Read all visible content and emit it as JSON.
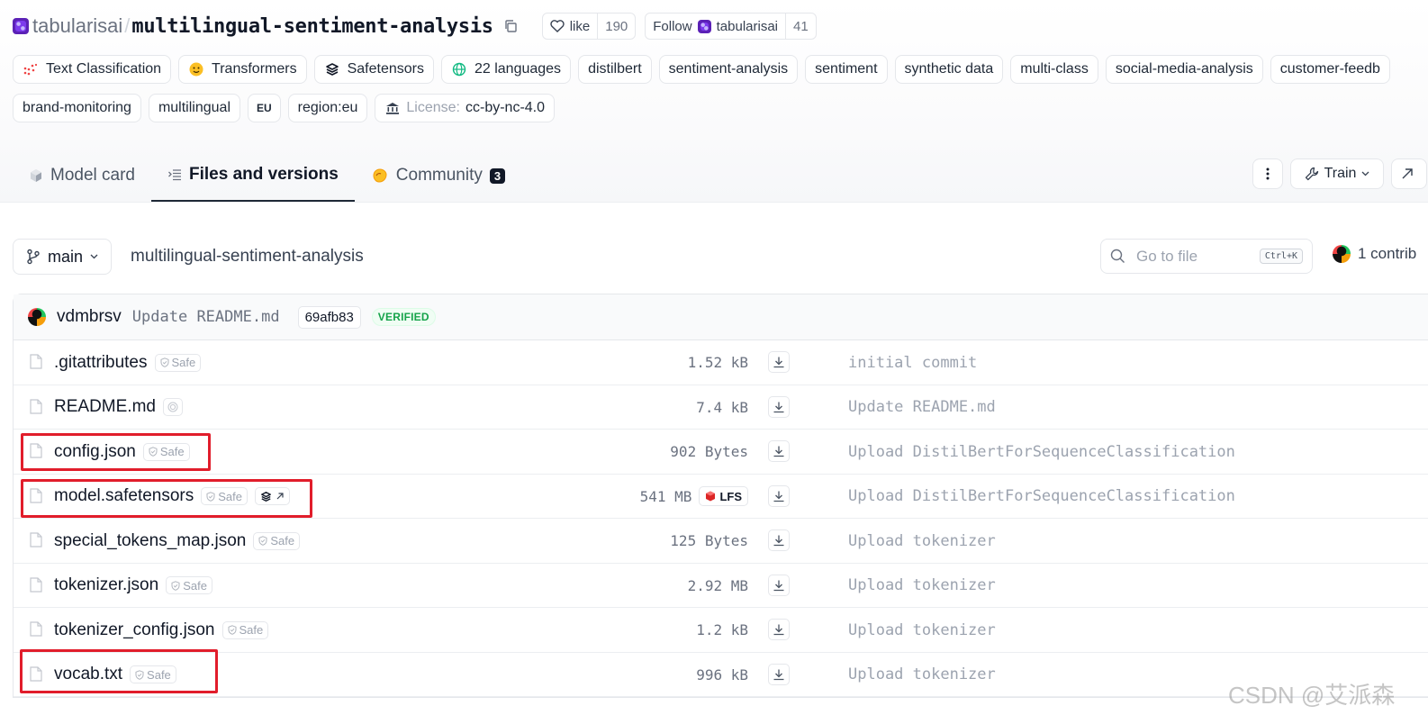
{
  "repo": {
    "org": "tabularisai",
    "separator": "/",
    "name": "multilingual-sentiment-analysis",
    "like_label": "like",
    "like_count": "190",
    "follow_label": "Follow",
    "follow_org": "tabularisai",
    "follow_count": "41"
  },
  "tags_row1": [
    {
      "label": "Text Classification",
      "icon": "text-classification-icon"
    },
    {
      "label": "Transformers",
      "icon": "hugging-face-icon"
    },
    {
      "label": "Safetensors",
      "icon": "safetensors-icon"
    },
    {
      "label": "22 languages",
      "icon": "globe-icon"
    },
    {
      "label": "distilbert"
    },
    {
      "label": "sentiment-analysis"
    },
    {
      "label": "sentiment"
    },
    {
      "label": "synthetic data"
    },
    {
      "label": "multi-class"
    },
    {
      "label": "social-media-analysis"
    },
    {
      "label": "customer-feedb"
    }
  ],
  "tags_row2": [
    {
      "label": "brand-monitoring"
    },
    {
      "label": "multilingual"
    },
    {
      "label": "EU"
    },
    {
      "label": "region:eu"
    },
    {
      "license_prefix": "License:",
      "label": "cc-by-nc-4.0",
      "icon": "bank-icon"
    }
  ],
  "tabs": {
    "model_card": "Model card",
    "files": "Files and versions",
    "community": "Community",
    "community_count": "3"
  },
  "actions": {
    "train": "Train"
  },
  "branch": {
    "name": "main",
    "path": "multilingual-sentiment-analysis"
  },
  "search": {
    "placeholder": "Go to file",
    "shortcut": "Ctrl+K"
  },
  "contributors": "1 contrib",
  "commit": {
    "author": "vdmbrsv",
    "message": "Update README.md",
    "sha": "69afb83",
    "verified": "VERIFIED"
  },
  "files": [
    {
      "name": ".gitattributes",
      "safe": "Safe",
      "size": "1.52 kB",
      "commit": "initial commit"
    },
    {
      "name": "README.md",
      "safe": "",
      "size": "7.4 kB",
      "commit": "Update README.md"
    },
    {
      "name": "config.json",
      "safe": "Safe",
      "size": "902 Bytes",
      "commit": "Upload DistilBertForSequenceClassification"
    },
    {
      "name": "model.safetensors",
      "safe": "Safe",
      "size": "541 MB",
      "lfs": "LFS",
      "commit": "Upload DistilBertForSequenceClassification"
    },
    {
      "name": "special_tokens_map.json",
      "safe": "Safe",
      "size": "125 Bytes",
      "commit": "Upload tokenizer"
    },
    {
      "name": "tokenizer.json",
      "safe": "Safe",
      "size": "2.92 MB",
      "commit": "Upload tokenizer"
    },
    {
      "name": "tokenizer_config.json",
      "safe": "Safe",
      "size": "1.2 kB",
      "commit": "Upload tokenizer"
    },
    {
      "name": "vocab.txt",
      "safe": "Safe",
      "size": "996 kB",
      "commit": "Upload tokenizer"
    }
  ],
  "highlight_color": "#e11d2b",
  "watermark": "CSDN @艾派森"
}
